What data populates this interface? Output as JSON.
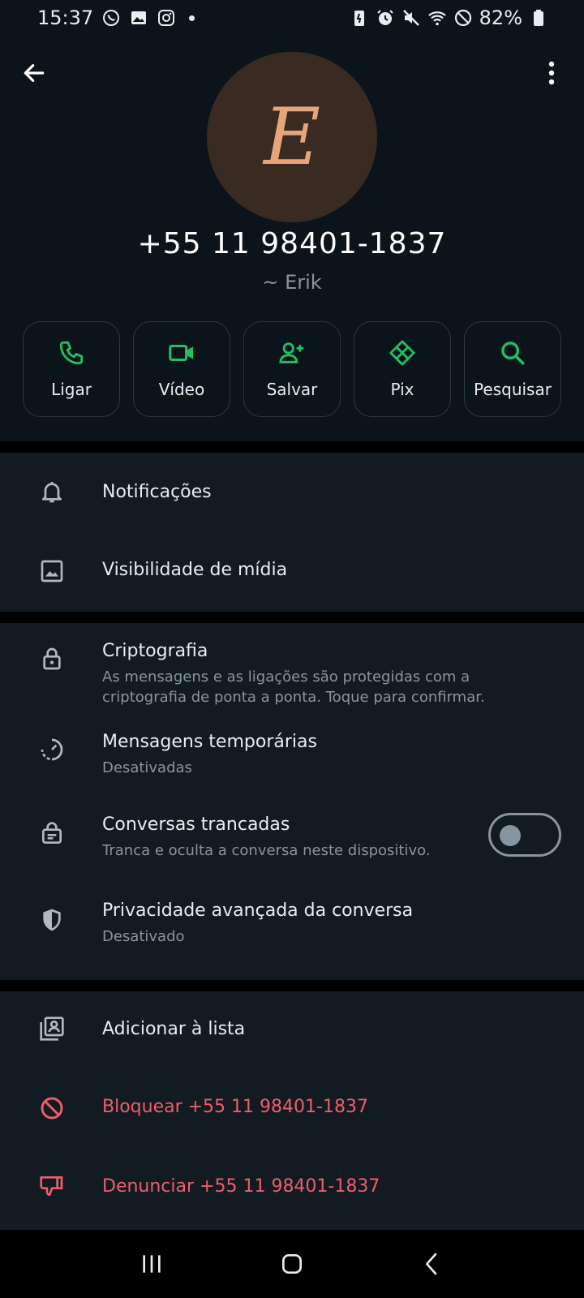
{
  "status_bar": {
    "time": "15:37",
    "battery": "82%"
  },
  "contact": {
    "avatar_letter": "E",
    "number": "+55 11 98401-1837",
    "name": "~ Erik"
  },
  "actions": [
    {
      "label": "Ligar",
      "icon": "phone-icon"
    },
    {
      "label": "Vídeo",
      "icon": "video-icon"
    },
    {
      "label": "Salvar",
      "icon": "add-contact-icon"
    },
    {
      "label": "Pix",
      "icon": "pix-icon"
    },
    {
      "label": "Pesquisar",
      "icon": "search-icon"
    }
  ],
  "section1": [
    {
      "title": "Notificações",
      "icon": "bell-icon"
    },
    {
      "title": "Visibilidade de mídia",
      "icon": "image-icon"
    }
  ],
  "section2": [
    {
      "title": "Criptografia",
      "subtitle": "As mensagens e as ligações são protegidas com a criptografia de ponta a ponta. Toque para confirmar.",
      "icon": "lock-icon"
    },
    {
      "title": "Mensagens temporárias",
      "subtitle": "Desativadas",
      "icon": "timer-icon"
    },
    {
      "title": "Conversas trancadas",
      "subtitle": "Tranca e oculta a conversa neste dispositivo.",
      "icon": "locked-chat-icon",
      "toggle": false
    },
    {
      "title": "Privacidade avançada da conversa",
      "subtitle": "Desativado",
      "icon": "shield-icon"
    }
  ],
  "section3": [
    {
      "title": "Adicionar à lista",
      "icon": "contact-list-icon"
    },
    {
      "title": "Bloquear +55 11 98401-1837",
      "icon": "block-icon"
    },
    {
      "title": "Denunciar +55 11 98401-1837",
      "icon": "thumbs-down-icon"
    }
  ],
  "colors": {
    "accent": "#21c063",
    "danger": "#f15c6d",
    "background": "#0b141a",
    "section": "#111b21"
  }
}
